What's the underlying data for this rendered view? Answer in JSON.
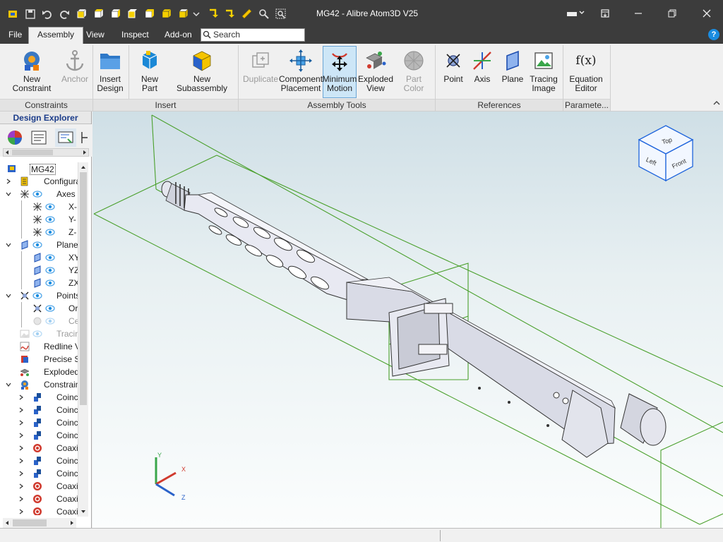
{
  "window": {
    "title": "MG42 - Alibre Atom3D V25"
  },
  "menu": {
    "tabs": [
      {
        "label": "File"
      },
      {
        "label": "Assembly"
      },
      {
        "label": "View"
      },
      {
        "label": "Inspect"
      },
      {
        "label": "Add-on"
      }
    ],
    "search_placeholder": "Search"
  },
  "ribbon": {
    "buttons": {
      "new_constraint": "New Constraint",
      "anchor": "Anchor",
      "insert_design": "Insert\nDesign",
      "new_part": "New Part",
      "new_subassembly": "New Subassembly",
      "duplicate": "Duplicate",
      "component_placement": "Component\nPlacement",
      "minimum_motion": "Minimum\nMotion",
      "exploded_view": "Exploded\nView",
      "part_color": "Part Color",
      "point": "Point",
      "axis": "Axis",
      "plane": "Plane",
      "tracing_image": "Tracing\nImage",
      "equation_editor": "Equation\nEditor"
    },
    "groups": {
      "constraints": "Constraints",
      "insert": "Insert",
      "assembly_tools": "Assembly Tools",
      "references": "References",
      "parameters": "Paramete..."
    }
  },
  "explorer": {
    "title": "Design Explorer",
    "tree": [
      {
        "label": "MG42"
      },
      {
        "label": "Configurat"
      },
      {
        "label": "Axes"
      },
      {
        "label": "X-"
      },
      {
        "label": "Y-"
      },
      {
        "label": "Z-"
      },
      {
        "label": "Planes"
      },
      {
        "label": "XY"
      },
      {
        "label": "YZ"
      },
      {
        "label": "ZX"
      },
      {
        "label": "Points"
      },
      {
        "label": "Or"
      },
      {
        "label": "Ce"
      },
      {
        "label": "Tracin"
      },
      {
        "label": "Redline V"
      },
      {
        "label": "Precise S"
      },
      {
        "label": "Exploded"
      },
      {
        "label": "Constraint"
      },
      {
        "label": "Coinci"
      },
      {
        "label": "Coinci"
      },
      {
        "label": "Coinci"
      },
      {
        "label": "Coinci"
      },
      {
        "label": "Coaxia"
      },
      {
        "label": "Coinci"
      },
      {
        "label": "Coinci"
      },
      {
        "label": "Coaxia"
      },
      {
        "label": "Coaxia"
      },
      {
        "label": "Coaxia"
      }
    ]
  },
  "viewcube": {
    "top": "Top",
    "left": "Left",
    "front": "Front"
  },
  "triad": {
    "x": "X",
    "y": "Y",
    "z": "Z"
  },
  "colors": {
    "titlebar": "#3c3c3c",
    "accent_blue": "#1a8ce0",
    "bounding_box": "#4aa02c",
    "viewcube": "#1e64dc"
  }
}
